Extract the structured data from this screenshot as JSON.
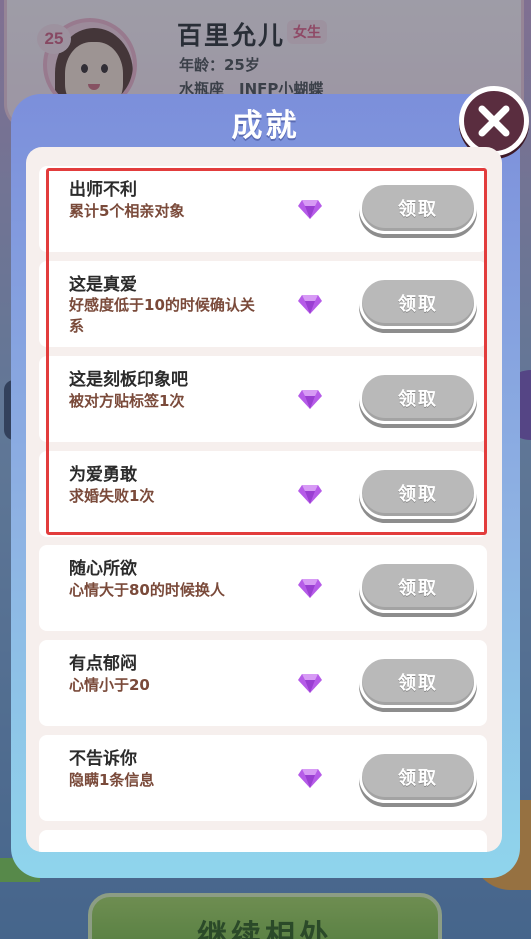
{
  "profile": {
    "level": "25",
    "name": "百里允儿",
    "gender": "女生",
    "age_line": "年龄：25岁",
    "sign_line": "水瓶座　INFP小蝴蝶"
  },
  "continue_label": "继续相处",
  "modal": {
    "title": "成就",
    "items": [
      {
        "title": "出师不利",
        "desc": "累计5个相亲对象",
        "button": "领取"
      },
      {
        "title": "这是真爱",
        "desc": "好感度低于10的时候确认关系",
        "button": "领取"
      },
      {
        "title": "这是刻板印象吧",
        "desc": "被对方贴标签1次",
        "button": "领取"
      },
      {
        "title": "为爱勇敢",
        "desc": "求婚失败1次",
        "button": "领取"
      },
      {
        "title": "随心所欲",
        "desc": "心情大于80的时候换人",
        "button": "领取"
      },
      {
        "title": "有点郁闷",
        "desc": "心情小于20",
        "button": "领取"
      },
      {
        "title": "不告诉你",
        "desc": "隐瞒1条信息",
        "button": "领取"
      }
    ]
  },
  "colors": {
    "highlight": "#e23c3c",
    "claim_disabled": "#b9b9b9",
    "gem": "#b65ce8"
  }
}
